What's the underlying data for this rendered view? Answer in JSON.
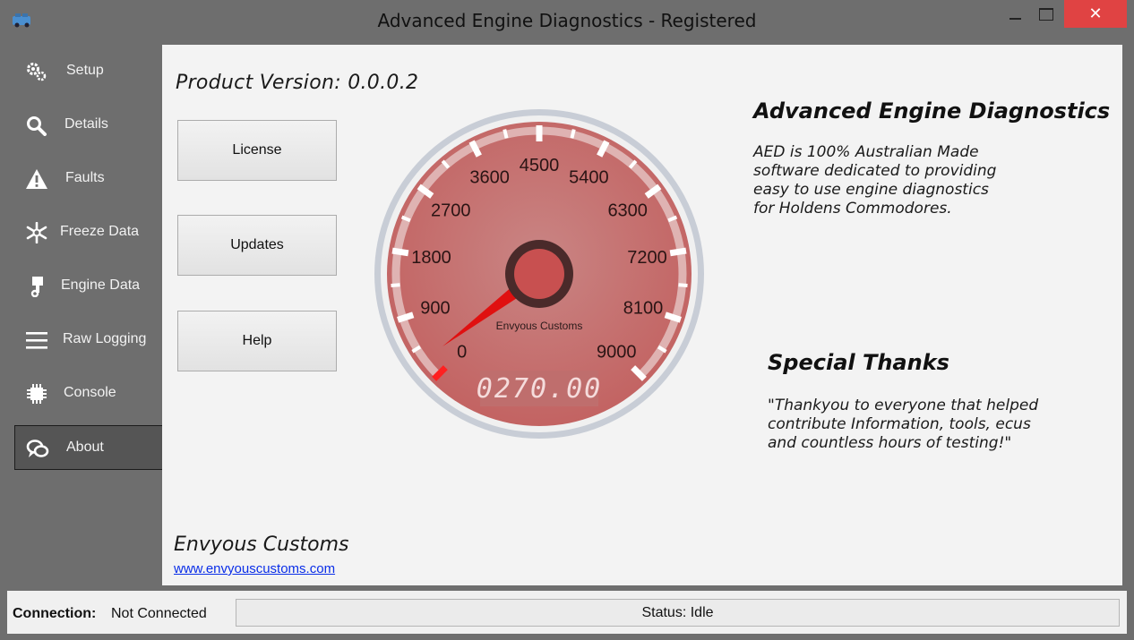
{
  "window": {
    "title": "Advanced Engine Diagnostics - Registered",
    "close_glyph": "✕"
  },
  "sidebar": {
    "items": [
      {
        "label": "Setup",
        "icon": "gears-icon"
      },
      {
        "label": "Details",
        "icon": "magnifier-icon"
      },
      {
        "label": "Faults",
        "icon": "warning-icon"
      },
      {
        "label": "Freeze Data",
        "icon": "snowflake-icon"
      },
      {
        "label": "Engine Data",
        "icon": "piston-icon"
      },
      {
        "label": "Raw Logging",
        "icon": "list-icon"
      },
      {
        "label": "Console",
        "icon": "chip-icon"
      },
      {
        "label": "About",
        "icon": "chat-icon",
        "active": true
      }
    ]
  },
  "about": {
    "product_version": "Product Version: 0.0.0.2",
    "buttons": {
      "license": "License",
      "updates": "Updates",
      "help": "Help"
    },
    "gauge": {
      "ticks": [
        "0",
        "900",
        "1800",
        "2700",
        "3600",
        "4500",
        "5400",
        "6300",
        "7200",
        "8100",
        "9000"
      ],
      "min": 0,
      "max": 9000,
      "value": 270,
      "readout": "0270.00",
      "brand": "Envyous Customs"
    },
    "aed_title": "Advanced Engine Diagnostics",
    "aed_lines": [
      "AED is 100% Australian Made",
      "software dedicated to providing",
      "easy to use engine diagnostics",
      "for Holdens Commodores."
    ],
    "thanks_title": "Special Thanks",
    "thanks_lines": [
      "\"Thankyou to everyone that helped",
      "contribute Information, tools, ecus",
      "and countless hours of testing!\""
    ],
    "company": "Envyous Customs",
    "website": "www.envyouscustoms.com"
  },
  "statusbar": {
    "connection_label": "Connection:",
    "connection_value": "Not Connected",
    "status": "Status: Idle"
  },
  "colors": {
    "sidebar_bg": "#6e6e6e",
    "content_bg": "#f3f3f3",
    "gauge_face": "#c97372",
    "needle": "#e01010",
    "close_button": "#e04343",
    "link": "#0a2ee8"
  }
}
